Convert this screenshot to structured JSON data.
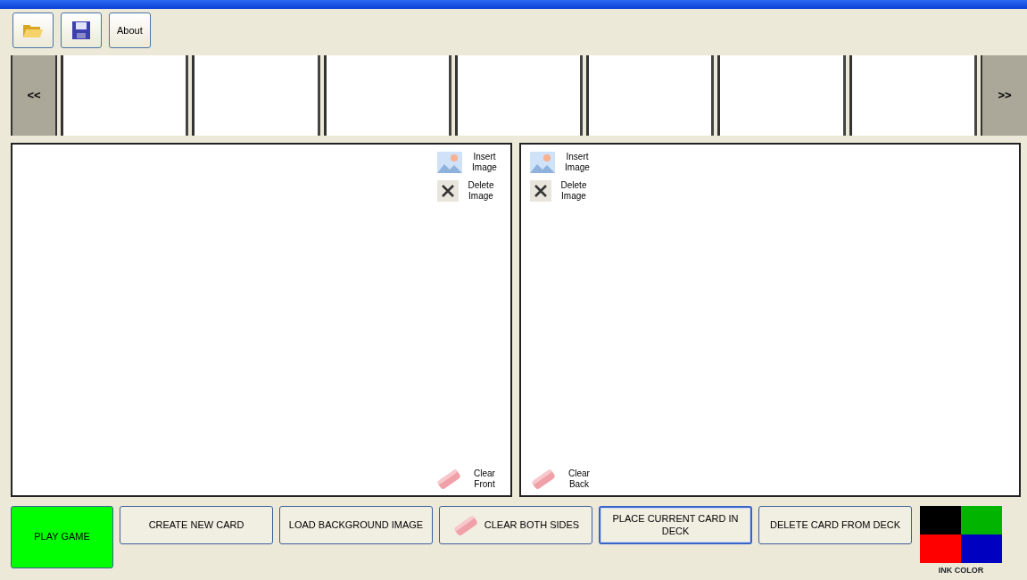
{
  "toolbar": [
    {
      "kind": "open"
    },
    {
      "kind": "save"
    },
    {
      "kind": "text",
      "label": "About"
    }
  ],
  "filmstrip": {
    "prev": "<<",
    "next": ">>",
    "slots": [
      {
        "kind": "blank"
      },
      {
        "kind": "blank"
      },
      {
        "kind": "blank"
      },
      {
        "kind": "blank"
      },
      {
        "kind": "blank"
      },
      {
        "kind": "blank"
      },
      {
        "kind": "blank"
      }
    ]
  },
  "panels": [
    {
      "kind": "front",
      "tools": [
        {
          "kind": "insert",
          "label": "Insert Image"
        },
        {
          "kind": "delete",
          "label": "Delete Image"
        }
      ],
      "clear": "Clear Front"
    },
    {
      "kind": "back",
      "tools": [
        {
          "kind": "insert",
          "label": "Insert Image"
        },
        {
          "kind": "delete",
          "label": "Delete Image"
        }
      ],
      "clear": "Clear Back"
    }
  ],
  "actions": [
    {
      "kind": "play",
      "label": "PLAY GAME",
      "color": "#00ff00",
      "focused": false
    },
    {
      "kind": "plain",
      "label": "CREATE NEW CARD",
      "focused": false
    },
    {
      "kind": "plain",
      "label": "LOAD BACKGROUND IMAGE",
      "focused": false
    },
    {
      "kind": "eraser",
      "label": "CLEAR BOTH SIDES",
      "focused": false
    },
    {
      "kind": "plain",
      "label": "PLACE CURRENT CARD IN DECK",
      "focused": true
    },
    {
      "kind": "plain",
      "label": "DELETE CARD FROM DECK",
      "focused": false
    }
  ],
  "ink": {
    "label": "INK COLOR",
    "swatches": [
      {
        "color": "#000000"
      },
      {
        "color": "#00b400"
      },
      {
        "color": "#ff0000"
      },
      {
        "color": "#0000c0"
      }
    ]
  }
}
